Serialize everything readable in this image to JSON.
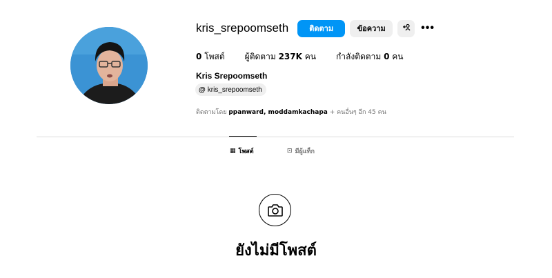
{
  "profile": {
    "username": "kris_srepoomseth",
    "follow_label": "ติดตาม",
    "message_label": "ข้อความ",
    "add_user_icon": "+ዶ",
    "more_icon": "•••",
    "full_name": "Kris Srepoomseth",
    "threads_handle": "kris_srepoomseth",
    "threads_icon": "@"
  },
  "stats": {
    "posts_count": "0",
    "posts_label": "โพสต์",
    "followers_label": "ผู้ติดตาม",
    "followers_count": "237K",
    "followers_unit": "คน",
    "following_label": "กำลังติดตาม",
    "following_count": "0",
    "following_unit": "คน"
  },
  "followed_by": {
    "prefix": "ติดตามโดย",
    "names": "ppanward, moddamkachapa",
    "suffix": "+ คนอื่นๆ อีก 45 คน"
  },
  "tabs": [
    {
      "icon": "▦",
      "label": "โพสต์",
      "active": true
    },
    {
      "icon": "⊡",
      "label": "มีผู้แท็ก",
      "active": false
    }
  ],
  "empty_state": {
    "title": "ยังไม่มีโพสต์",
    "icon": "camera-icon"
  },
  "colors": {
    "accent": "#0095f6",
    "secondary_button": "#efefef",
    "muted_text": "#737373",
    "divider": "#dbdbdb"
  }
}
